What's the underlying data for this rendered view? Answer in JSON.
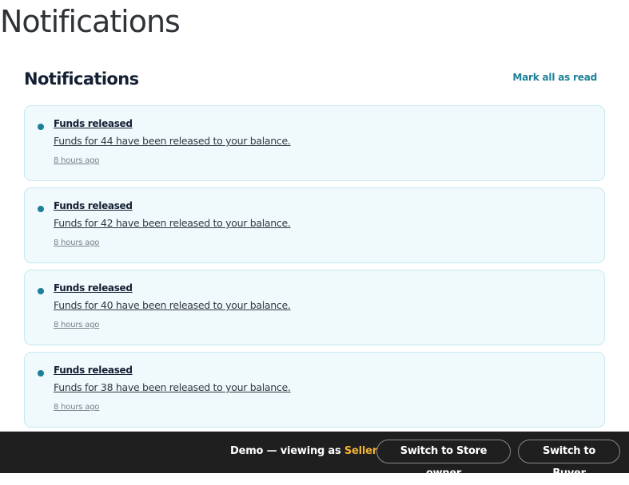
{
  "page": {
    "title": "Notifications"
  },
  "panel": {
    "title": "Notifications",
    "mark_all_label": "Mark all as read"
  },
  "notifications": [
    {
      "title": "Funds released",
      "body": "Funds for 44 have been released to your balance.",
      "time": "8 hours ago",
      "unread": true
    },
    {
      "title": "Funds released",
      "body": "Funds for 42 have been released to your balance.",
      "time": "8 hours ago",
      "unread": true
    },
    {
      "title": "Funds released",
      "body": "Funds for 40 have been released to your balance.",
      "time": "8 hours ago",
      "unread": true
    },
    {
      "title": "Funds released",
      "body": "Funds for 38 have been released to your balance.",
      "time": "8 hours ago",
      "unread": true
    }
  ],
  "demo_bar": {
    "prefix": "Demo — viewing as ",
    "role": "Seller",
    "switch_store_owner_label": "Switch to Store owner",
    "switch_buyer_label": "Switch to Buyer"
  },
  "colors": {
    "accent": "#1b7f98",
    "card_bg": "#f0f9fc",
    "card_border": "#c8e9f1",
    "demo_bar_bg": "#1f1f1f",
    "role_highlight": "#f2b233"
  }
}
